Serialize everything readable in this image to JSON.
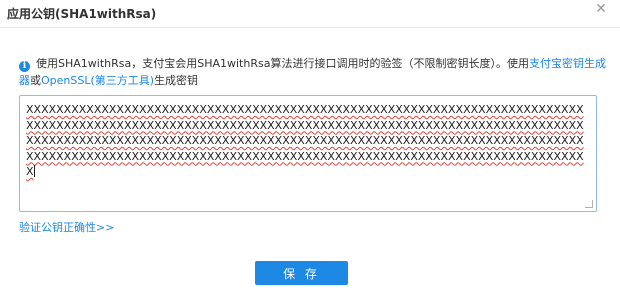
{
  "dialog": {
    "title": "应用公钥(SHA1withRsa)",
    "close_icon": "close-icon"
  },
  "info": {
    "icon": "info-icon",
    "text_before": "使用SHA1withRsa，支付宝会用SHA1withRsa算法进行接口调用时的验签（不限制密钥长度）。使用",
    "link1": "支付宝密钥生成器",
    "text_middle": "或",
    "link2": "OpenSSL(第三方工具)",
    "text_after": "生成密钥"
  },
  "key_input": {
    "value": "XXXXXXXXXXXXXXXXXXXXXXXXXXXXXXXXXXXXXXXXXXXXXXXXXXXXXXXXXXXXXXXXXXXXXXXXXXXXXXXXXXXXXXXXXXXXXXXXXXXXXXXXXXXXXXXXXXXXXXXXXXXXXXXXXXXXXXXXXXXXXXXXXXXXXXXXXXXXXXXXXXXXXXXXXXXXXXXXXXXXXXXXXXXXXXXXXXXXXXXXXXXXXXXXXXXXXXXXXXXXXXXXXXXXXXXXXXXXXXXXXXXXXXXXXXXXXXXXXXXXXXXXXXXXXXXXXXXXXXXXXXXXXXXXXXXXXXXXX"
  },
  "verify_link": "验证公钥正确性>>",
  "save_button": "保 存",
  "colors": {
    "accent": "#1e88e5",
    "input_border": "#93bce6",
    "spellcheck": "#e0433b"
  }
}
